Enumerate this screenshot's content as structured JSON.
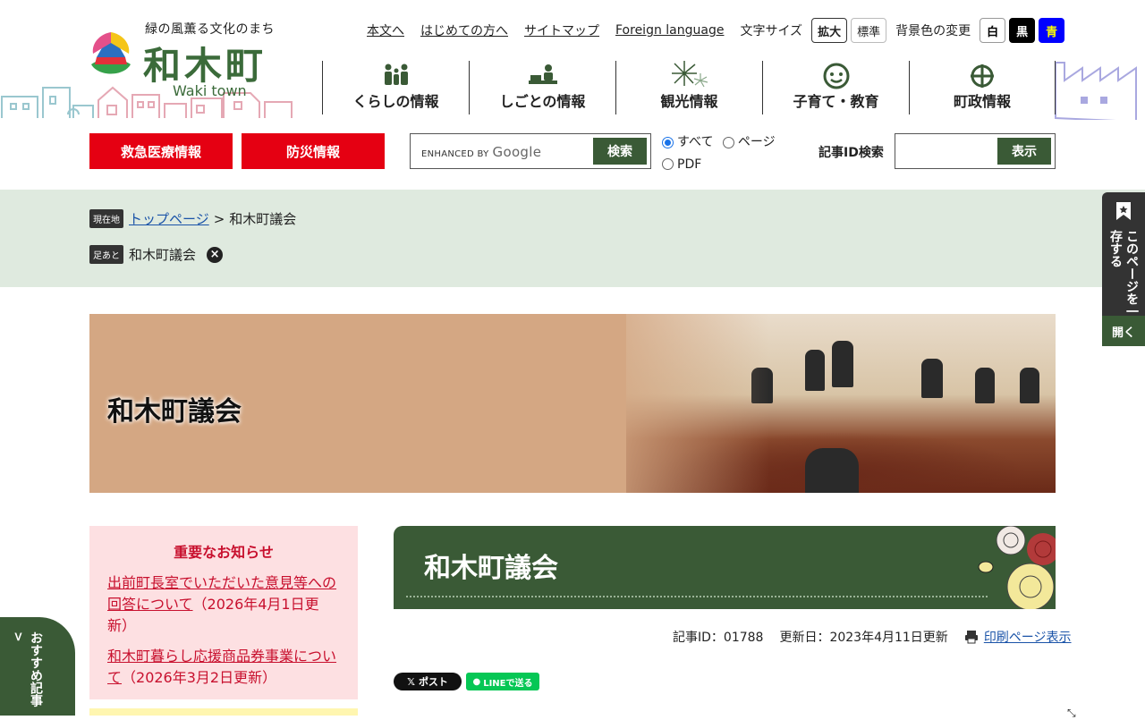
{
  "logo": {
    "tagline": "緑の風薫る文化のまち",
    "name": "和木町",
    "english": "Waki town"
  },
  "utility": {
    "links": [
      "本文へ",
      "はじめての方へ",
      "サイトマップ",
      "Foreign language"
    ],
    "font_size_label": "文字サイズ",
    "font_buttons": [
      "拡大",
      "標準"
    ],
    "bg_label": "背景色の変更",
    "bg_buttons": [
      {
        "label": "白",
        "bg": "#ffffff",
        "fg": "#000000"
      },
      {
        "label": "黒",
        "bg": "#000000",
        "fg": "#ffffff"
      },
      {
        "label": "青",
        "bg": "#0000ff",
        "fg": "#ffff00"
      }
    ]
  },
  "gnav": [
    {
      "label": "くらしの情報",
      "icon": "family-icon"
    },
    {
      "label": "しごとの情報",
      "icon": "work-desk-icon"
    },
    {
      "label": "観光情報",
      "icon": "fireworks-icon"
    },
    {
      "label": "子育て・教育",
      "icon": "child-face-icon"
    },
    {
      "label": "町政情報",
      "icon": "town-emblem-icon"
    }
  ],
  "emergency": {
    "medical": "救急医療情報",
    "disaster": "防災情報"
  },
  "search": {
    "enhanced_by": "ENHANCED BY",
    "google": "Google",
    "button": "検索",
    "options": [
      {
        "label": "すべて",
        "checked": true
      },
      {
        "label": "ページ",
        "checked": false
      },
      {
        "label": "PDF",
        "checked": false
      }
    ]
  },
  "article_id_search": {
    "label": "記事ID検索",
    "button": "表示"
  },
  "breadcrumb": {
    "current_tag": "現在地",
    "home": "トップページ",
    "sep": ">",
    "current": "和木町議会",
    "history_tag": "足あと",
    "history_item": "和木町議会"
  },
  "hero": {
    "title": "和木町議会"
  },
  "notice": {
    "title": "重要なお知らせ",
    "items": [
      {
        "link": "出前町長室でいただいた意見等への回答について",
        "date": "（2026年4月1日更新）"
      },
      {
        "link": "和木町暮らし応援商品券事業について",
        "date": "（2026年3月2日更新）"
      }
    ]
  },
  "article": {
    "title": "和木町議会",
    "id_label": "記事ID：01788",
    "updated": "更新日：2023年4月11日更新",
    "print": "印刷ページ表示"
  },
  "share": {
    "x": "ポスト",
    "line": "LINEで送る"
  },
  "side_widget": {
    "text": "このページを一時保存する",
    "open": "開く"
  },
  "recommend": {
    "text": "おすすめ記事 >"
  },
  "colors": {
    "green": "#3a5a36",
    "red": "#e50012",
    "band": "#dfeadf",
    "notice_bg": "#fde0e2"
  }
}
